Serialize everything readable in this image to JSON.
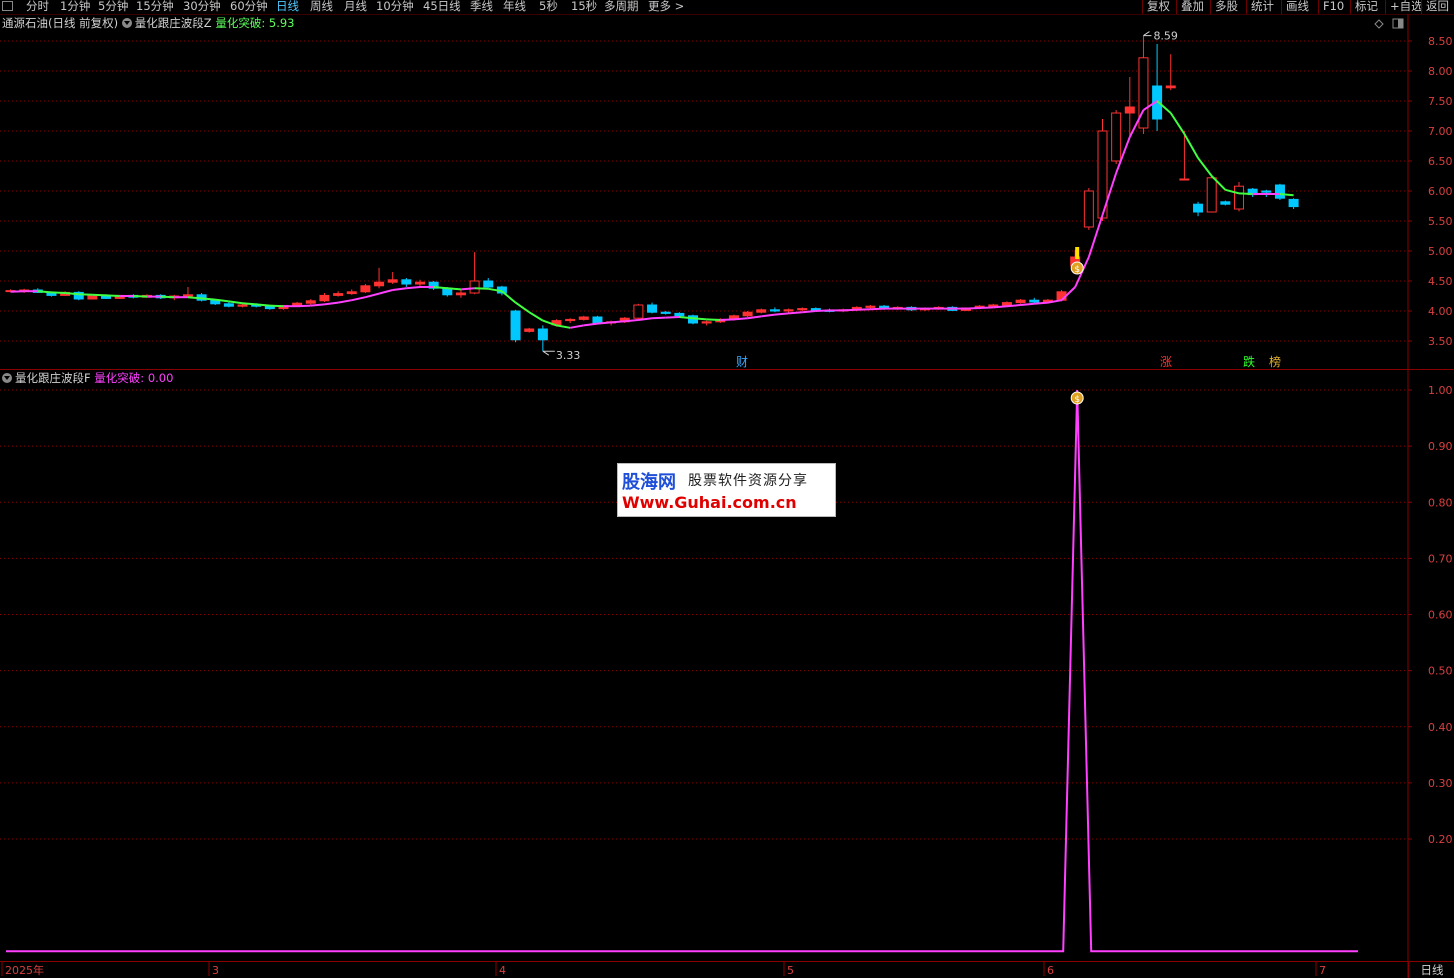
{
  "toolbar": {
    "periods": [
      "分时",
      "1分钟",
      "5分钟",
      "15分钟",
      "30分钟",
      "60分钟",
      "日线",
      "周线",
      "月线",
      "10分钟",
      "45日线",
      "季线",
      "年线",
      "5秒",
      "15秒",
      "多周期",
      "更多 >"
    ],
    "active_period": "日线",
    "right_buttons": [
      "复权",
      "叠加",
      "多股",
      "统计",
      "画线",
      "F10",
      "标记",
      "+自选",
      "返回"
    ]
  },
  "main_panel": {
    "title": "通源石油(日线 前复权)",
    "indicator_name": "量化跟庄波段Z",
    "indicator_label": "量化突破:",
    "indicator_value": "5.93",
    "y_ticks": [
      "8.50",
      "8.00",
      "7.50",
      "7.00",
      "6.50",
      "6.00",
      "5.50",
      "5.00",
      "4.50",
      "4.00",
      "3.50"
    ],
    "high_label": "8.59",
    "low_label": "3.33",
    "event_markers": [
      {
        "text": "财",
        "color": "#3aa8ff"
      },
      {
        "text": "涨",
        "color": "#ff3030"
      },
      {
        "text": "跌",
        "color": "#30ff30"
      },
      {
        "text": "榜",
        "color": "#e0b030"
      }
    ]
  },
  "sub_panel": {
    "indicator_name": "量化跟庄波段F",
    "indicator_label": "量化突破:",
    "indicator_value": "0.00",
    "y_ticks": [
      "1.00",
      "0.90",
      "0.80",
      "0.70",
      "0.60",
      "0.50",
      "0.40",
      "0.30",
      "0.20"
    ]
  },
  "x_axis_labels": [
    "2025年",
    "3",
    "4",
    "5",
    "6",
    "7"
  ],
  "period_label": "日线",
  "watermark": {
    "logo": "股海网",
    "tagline": "股票软件资源分享",
    "url": "Www.Guhai.com.cn"
  },
  "colors": {
    "up": "#ff3232",
    "down": "#00c8ff",
    "ma_up": "#ff40ff",
    "ma_down": "#40ff40",
    "sub_line": "#ff40ff",
    "grid": "#8a0000"
  },
  "chart_data": {
    "type": "candlestick",
    "x_range": [
      "2025-02",
      "2025-07"
    ],
    "ylim": [
      3.3,
      8.7
    ],
    "sub_ylim": [
      0,
      1.0
    ],
    "candles": [
      [
        4.34,
        4.36,
        4.32,
        4.34
      ],
      [
        4.34,
        4.37,
        4.3,
        4.35
      ],
      [
        4.35,
        4.38,
        4.3,
        4.31
      ],
      [
        4.31,
        4.32,
        4.24,
        4.26
      ],
      [
        4.26,
        4.33,
        4.25,
        4.31
      ],
      [
        4.31,
        4.33,
        4.18,
        4.2
      ],
      [
        4.2,
        4.26,
        4.19,
        4.25
      ],
      [
        4.25,
        4.28,
        4.2,
        4.21
      ],
      [
        4.21,
        4.27,
        4.2,
        4.26
      ],
      [
        4.26,
        4.28,
        4.21,
        4.23
      ],
      [
        4.23,
        4.28,
        4.22,
        4.26
      ],
      [
        4.26,
        4.28,
        4.2,
        4.22
      ],
      [
        4.22,
        4.27,
        4.18,
        4.25
      ],
      [
        4.25,
        4.4,
        4.22,
        4.27
      ],
      [
        4.27,
        4.3,
        4.16,
        4.18
      ],
      [
        4.18,
        4.2,
        4.1,
        4.12
      ],
      [
        4.12,
        4.15,
        4.06,
        4.08
      ],
      [
        4.08,
        4.12,
        4.06,
        4.1
      ],
      [
        4.1,
        4.13,
        4.06,
        4.08
      ],
      [
        4.08,
        4.1,
        4.02,
        4.04
      ],
      [
        4.04,
        4.1,
        4.02,
        4.09
      ],
      [
        4.09,
        4.15,
        4.07,
        4.13
      ],
      [
        4.13,
        4.2,
        4.1,
        4.17
      ],
      [
        4.17,
        4.3,
        4.15,
        4.26
      ],
      [
        4.26,
        4.33,
        4.24,
        4.29
      ],
      [
        4.29,
        4.36,
        4.27,
        4.32
      ],
      [
        4.32,
        4.45,
        4.3,
        4.42
      ],
      [
        4.42,
        4.72,
        4.38,
        4.48
      ],
      [
        4.48,
        4.65,
        4.45,
        4.52
      ],
      [
        4.52,
        4.55,
        4.4,
        4.45
      ],
      [
        4.45,
        4.52,
        4.4,
        4.48
      ],
      [
        4.48,
        4.5,
        4.35,
        4.38
      ],
      [
        4.38,
        4.4,
        4.24,
        4.27
      ],
      [
        4.27,
        4.35,
        4.22,
        4.3
      ],
      [
        4.3,
        4.98,
        4.28,
        4.5
      ],
      [
        4.5,
        4.55,
        4.38,
        4.4
      ],
      [
        4.4,
        4.42,
        4.26,
        4.3
      ],
      [
        4.0,
        4.02,
        3.48,
        3.52
      ],
      [
        3.66,
        3.72,
        3.64,
        3.7
      ],
      [
        3.7,
        3.76,
        3.33,
        3.52
      ],
      [
        3.77,
        3.86,
        3.74,
        3.84
      ],
      [
        3.84,
        3.88,
        3.8,
        3.86
      ],
      [
        3.86,
        3.92,
        3.84,
        3.9
      ],
      [
        3.9,
        3.92,
        3.78,
        3.8
      ],
      [
        3.8,
        3.84,
        3.76,
        3.82
      ],
      [
        3.82,
        3.9,
        3.8,
        3.88
      ],
      [
        3.88,
        4.12,
        3.86,
        4.1
      ],
      [
        4.1,
        4.14,
        3.96,
        3.98
      ],
      [
        3.98,
        4.0,
        3.94,
        3.96
      ],
      [
        3.96,
        3.98,
        3.9,
        3.92
      ],
      [
        3.92,
        3.94,
        3.78,
        3.8
      ],
      [
        3.8,
        3.84,
        3.76,
        3.82
      ],
      [
        3.82,
        3.88,
        3.8,
        3.86
      ],
      [
        3.86,
        3.94,
        3.84,
        3.92
      ],
      [
        3.92,
        4.0,
        3.9,
        3.98
      ],
      [
        3.98,
        4.04,
        3.96,
        4.02
      ],
      [
        4.02,
        4.06,
        3.98,
        4.0
      ],
      [
        4.0,
        4.04,
        3.96,
        4.02
      ],
      [
        4.02,
        4.06,
        4.0,
        4.04
      ],
      [
        4.04,
        4.06,
        4.0,
        4.01
      ],
      [
        4.01,
        4.04,
        3.98,
        4.0
      ],
      [
        4.0,
        4.04,
        3.98,
        4.02
      ],
      [
        4.02,
        4.08,
        4.0,
        4.06
      ],
      [
        4.06,
        4.1,
        4.04,
        4.08
      ],
      [
        4.08,
        4.1,
        4.02,
        4.04
      ],
      [
        4.04,
        4.08,
        4.02,
        4.06
      ],
      [
        4.06,
        4.08,
        4.0,
        4.02
      ],
      [
        4.02,
        4.06,
        4.0,
        4.04
      ],
      [
        4.04,
        4.08,
        4.02,
        4.06
      ],
      [
        4.06,
        4.08,
        4.0,
        4.01
      ],
      [
        4.01,
        4.06,
        4.0,
        4.05
      ],
      [
        4.05,
        4.1,
        4.03,
        4.08
      ],
      [
        4.08,
        4.12,
        4.06,
        4.1
      ],
      [
        4.1,
        4.16,
        4.08,
        4.14
      ],
      [
        4.14,
        4.2,
        4.12,
        4.18
      ],
      [
        4.18,
        4.22,
        4.12,
        4.15
      ],
      [
        4.15,
        4.2,
        4.13,
        4.18
      ],
      [
        4.18,
        4.35,
        4.16,
        4.32
      ],
      [
        4.75,
        5.02,
        4.72,
        4.9
      ],
      [
        5.4,
        6.05,
        5.35,
        6.0
      ],
      [
        5.55,
        7.2,
        5.5,
        7.0
      ],
      [
        6.5,
        7.35,
        6.45,
        7.3
      ],
      [
        7.3,
        7.9,
        6.9,
        7.4
      ],
      [
        7.05,
        8.59,
        6.95,
        8.22
      ],
      [
        7.75,
        8.45,
        7.0,
        7.2
      ],
      [
        7.72,
        8.28,
        7.68,
        7.75
      ],
      [
        6.2,
        7.0,
        6.18,
        6.2
      ],
      [
        5.78,
        5.82,
        5.58,
        5.65
      ],
      [
        5.65,
        6.25,
        5.64,
        6.22
      ],
      [
        5.82,
        5.84,
        5.76,
        5.78
      ],
      [
        5.7,
        6.15,
        5.66,
        6.08
      ],
      [
        6.03,
        6.05,
        5.9,
        5.94
      ],
      [
        6.0,
        6.02,
        5.9,
        5.98
      ],
      [
        6.1,
        6.12,
        5.85,
        5.88
      ],
      [
        5.86,
        5.88,
        5.7,
        5.74
      ]
    ],
    "ma_line": [
      4.32,
      4.33,
      4.33,
      4.31,
      4.3,
      4.28,
      4.27,
      4.26,
      4.25,
      4.25,
      4.24,
      4.24,
      4.23,
      4.23,
      4.21,
      4.19,
      4.16,
      4.13,
      4.11,
      4.09,
      4.08,
      4.08,
      4.09,
      4.11,
      4.14,
      4.18,
      4.23,
      4.29,
      4.35,
      4.38,
      4.4,
      4.4,
      4.38,
      4.36,
      4.38,
      4.37,
      4.33,
      4.14,
      3.98,
      3.84,
      3.76,
      3.72,
      3.76,
      3.79,
      3.81,
      3.83,
      3.85,
      3.88,
      3.89,
      3.9,
      3.88,
      3.86,
      3.85,
      3.86,
      3.88,
      3.91,
      3.94,
      3.96,
      3.98,
      4.0,
      4.01,
      4.01,
      4.02,
      4.03,
      4.04,
      4.04,
      4.04,
      4.04,
      4.04,
      4.04,
      4.04,
      4.05,
      4.06,
      4.08,
      4.1,
      4.12,
      4.14,
      4.18,
      4.4,
      4.9,
      5.6,
      6.3,
      6.9,
      7.35,
      7.5,
      7.3,
      6.95,
      6.55,
      6.25,
      6.02,
      5.96,
      5.95,
      5.95,
      5.95,
      5.93
    ],
    "sub_signal": {
      "peak_index": 78,
      "peak_value": 1.0,
      "baseline": 0.0
    }
  }
}
